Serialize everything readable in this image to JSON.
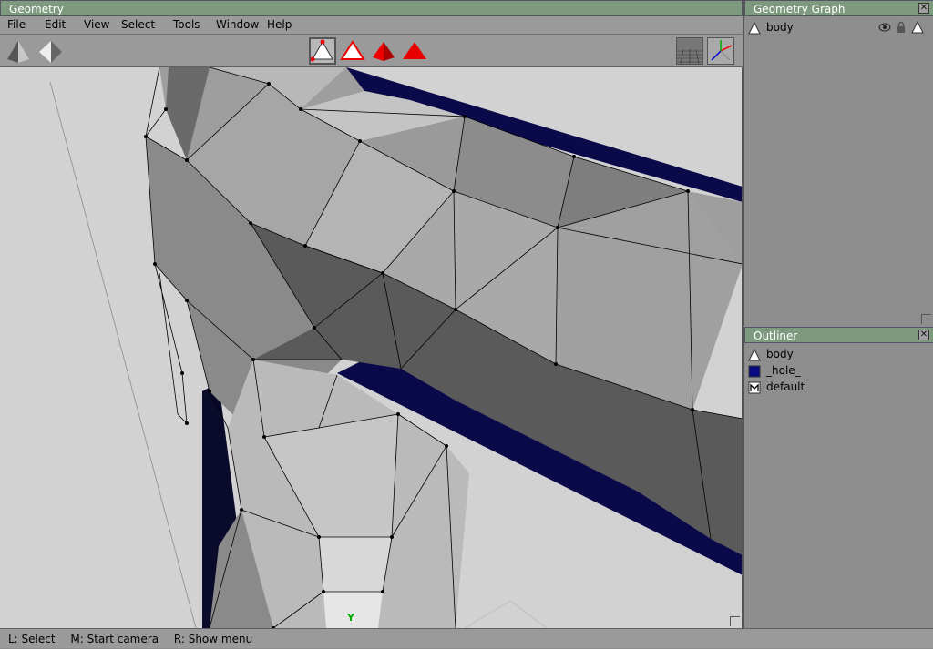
{
  "main_window": {
    "title": "Geometry",
    "menu": [
      "File",
      "Edit",
      "View",
      "Select",
      "Tools",
      "Window",
      "Help"
    ],
    "axis_label": "Y"
  },
  "geometry_graph": {
    "title": "Geometry Graph",
    "close": "✕",
    "items": [
      {
        "label": "body"
      }
    ]
  },
  "outliner": {
    "title": "Outliner",
    "close": "✕",
    "items": [
      {
        "label": "body",
        "icon": "triangle-icon"
      },
      {
        "label": "_hole_",
        "icon": "blue-square-icon",
        "color": "#0a0a80"
      },
      {
        "label": "default",
        "icon": "material-icon"
      }
    ]
  },
  "status": {
    "hints": [
      "L: Select",
      "M: Start camera",
      "R: Show menu"
    ]
  },
  "colors": {
    "title_bar": "#7e9a7e",
    "hole": "#0a0a4a"
  }
}
